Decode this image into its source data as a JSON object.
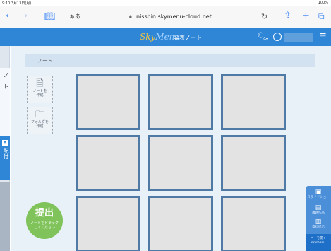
{
  "status": {
    "time": "9:10  3月13日(月)",
    "battery": "100%"
  },
  "browser": {
    "url": "nisshin.skymenu-cloud.net",
    "text_size_label": "ぁあ",
    "icons": [
      "chevron-left-icon",
      "chevron-right-icon",
      "book-icon",
      "lock-icon",
      "reload-icon",
      "share-icon",
      "plus-icon",
      "tabs-icon"
    ]
  },
  "header": {
    "logo_part1": "Sky",
    "logo_part2": "Menu",
    "title": "発表ノート",
    "colors": {
      "bar": "#2f86d7",
      "logo": "#f2c542"
    }
  },
  "sidebar": {
    "note_tab": "ノート",
    "distribute_tab": "配付",
    "distribute_icon": "▾"
  },
  "main": {
    "breadcrumb": "ノート",
    "create_note": {
      "line1": "ノートを",
      "line2": "作成"
    },
    "create_folder": {
      "line1": "フォルダを",
      "line2": "作成"
    },
    "submit": {
      "title": "提出",
      "hint_line1": "ノートをドラッグ",
      "hint_line2": "してください"
    },
    "thumbnail_count": 9
  },
  "tools": {
    "slideshow": "スライドショー",
    "works": "課題作品",
    "materials": "資料提示",
    "bar_line1": "バーを開く",
    "bar_line2": "skymenu"
  }
}
